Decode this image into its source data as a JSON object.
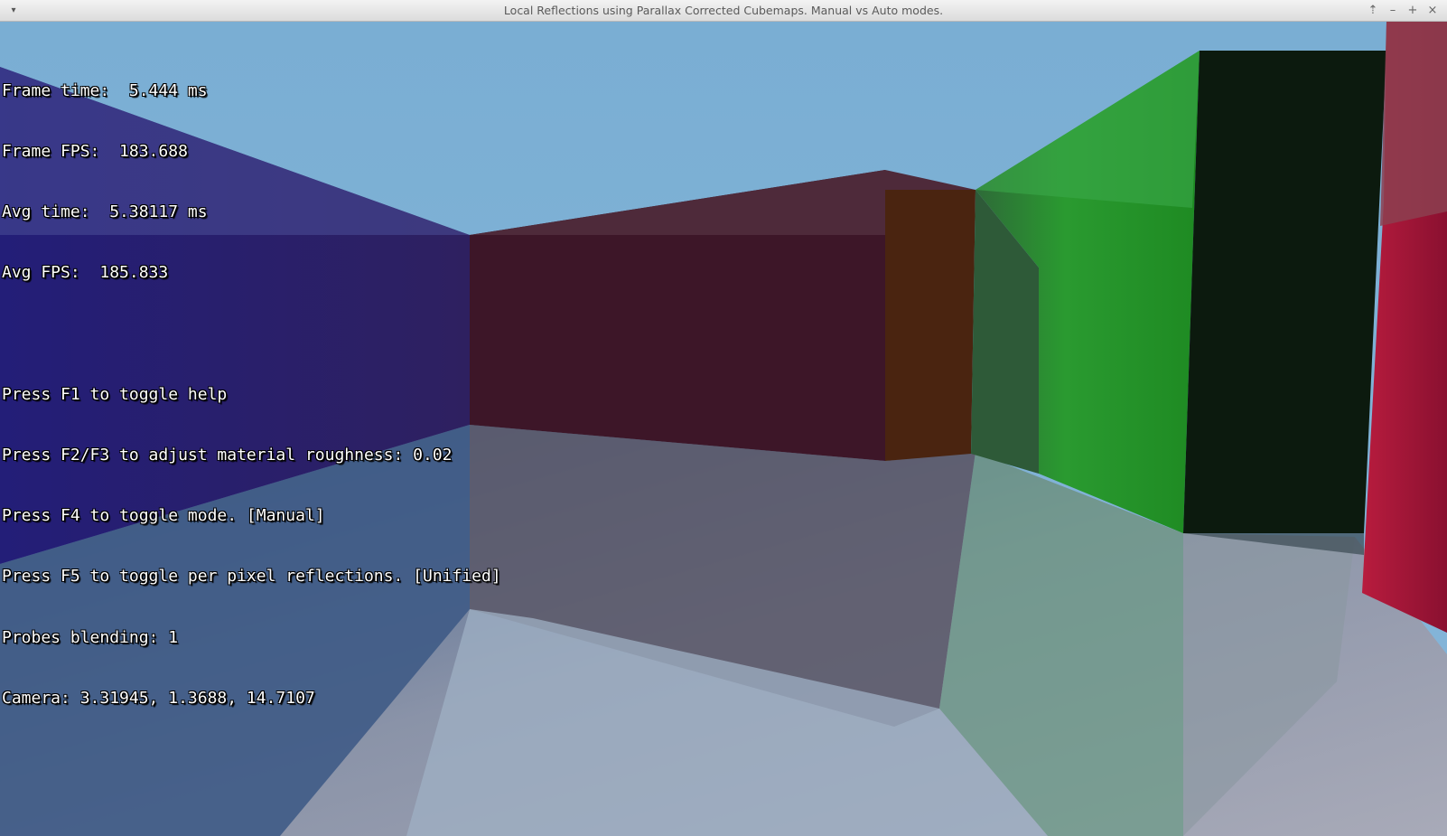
{
  "window": {
    "title": "Local Reflections using Parallax Corrected Cubemaps. Manual vs Auto modes.",
    "controls": {
      "menu": "▾",
      "up": "⇡",
      "minimize": "–",
      "maximize": "+",
      "close": "×"
    }
  },
  "hud": {
    "frame_time": "Frame time:  5.444 ms",
    "frame_fps": "Frame FPS:  183.688",
    "avg_time": "Avg time:  5.38117 ms",
    "avg_fps": "Avg FPS:  185.833",
    "help": "Press F1 to toggle help",
    "roughness": "Press F2/F3 to adjust material roughness: 0.02",
    "mode": "Press F4 to toggle mode. [Manual]",
    "reflections": "Press F5 to toggle per pixel reflections. [Unified]",
    "blending": "Probes blending: 1",
    "camera": "Camera: 3.31945, 1.3688, 14.7107"
  },
  "colors": {
    "sky": "#7aaed3",
    "blue_wall": "#2a2470",
    "maroon_wall": "#3d1628",
    "orange_panel": "#4a2410",
    "green_wall": "#2a8f30",
    "dark_panel": "#0c1a0e",
    "red_wall": "#a8183a",
    "floor": "#8f9bb0"
  }
}
